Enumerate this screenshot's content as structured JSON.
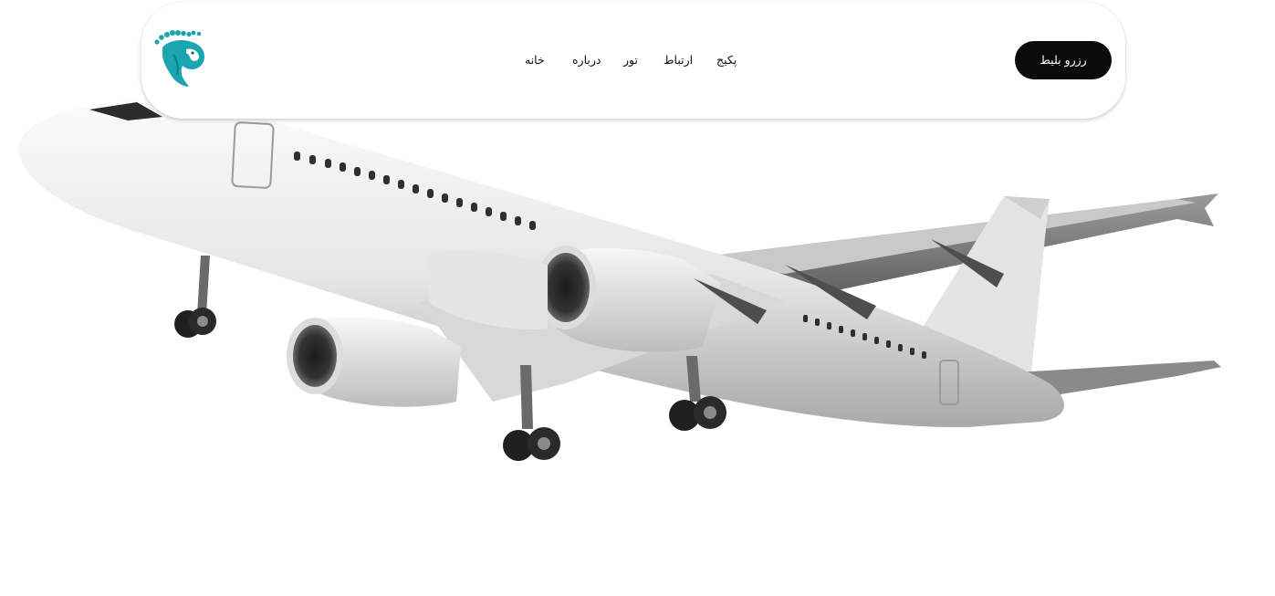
{
  "header": {
    "logo_icon": "seahorse-logo-icon",
    "nav": {
      "home": "خانه",
      "about": "درباره",
      "tour": "تور",
      "contact": "ارتباط",
      "package": "پکیج"
    },
    "book_ticket_label": "رزرو بلیط"
  },
  "hero": {
    "image": "airplane-photo"
  },
  "colors": {
    "logo_teal": "#1aa5b0",
    "button_bg": "#0b0b0b",
    "button_text": "#ffffff",
    "nav_text": "#111111",
    "page_bg": "#ffffff"
  }
}
